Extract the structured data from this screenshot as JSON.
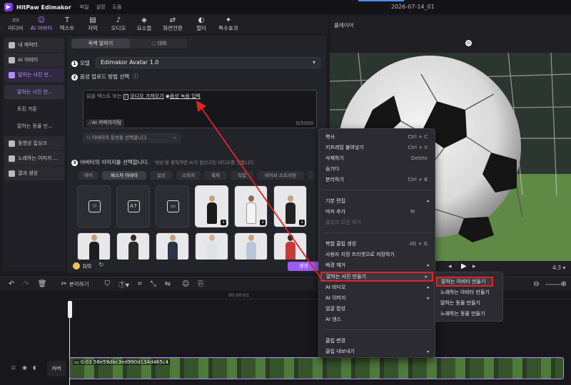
{
  "titlebar": {
    "app": "HitPaw Edimakor",
    "menus": [
      "파일",
      "설정",
      "도움"
    ],
    "date": "2026-07-14_01"
  },
  "tabs": [
    {
      "icon": "media-icon",
      "glyph": "▭",
      "label": "미디어"
    },
    {
      "icon": "ai-avatar-icon",
      "glyph": "☺",
      "label": "AI 아바타"
    },
    {
      "icon": "text-icon",
      "glyph": "T",
      "label": "텍스트"
    },
    {
      "icon": "subtitle-icon",
      "glyph": "▤",
      "label": "자막"
    },
    {
      "icon": "audio-icon",
      "glyph": "♪",
      "label": "오디오"
    },
    {
      "icon": "elements-icon",
      "glyph": "◈",
      "label": "요소들"
    },
    {
      "icon": "transition-icon",
      "glyph": "⇄",
      "label": "화면전환"
    },
    {
      "icon": "filter-icon",
      "glyph": "◐",
      "label": "필터"
    },
    {
      "icon": "effects-icon",
      "glyph": "✦",
      "label": "특수효과"
    }
  ],
  "sidebar": {
    "items": [
      {
        "label": "내 캐릭터"
      },
      {
        "label": "AI 아바타"
      },
      {
        "label": "말하는 사진 만..."
      },
      {
        "label": "말하는 사진 만..."
      },
      {
        "label": "토킹 카툰"
      },
      {
        "label": "말하는 동물 만..."
      },
      {
        "label": "동영상 립싱크"
      },
      {
        "label": "노래하는 이미지 ..."
      },
      {
        "label": "결과 생성"
      }
    ]
  },
  "main": {
    "seg_tabs": [
      "독백 말하기",
      "대화"
    ],
    "step1_label": "모델",
    "model_value": "Edimakor Avatar 1.0",
    "step2_label": "음성 업로드 방법 선택",
    "textarea_hint_prefix": "읽을 텍스트 또는",
    "import_audio": "오디오 가져오기",
    "record_audio": "음성 녹음 입력",
    "ai_copywriting": "AI 카피라이팅",
    "char_count": "0/5000",
    "voice_select": "아바타의 음성을 선택합니다.",
    "step3_label": "아바타의 이미지를 선택합니다.",
    "step3_hint": "'생성'을 클릭하면 AI가 립싱크된 비디오를 만듭니다.",
    "categories": [
      "마이",
      "제스처 아바타",
      "일상",
      "스피치",
      "축제",
      "직업",
      "라이브 스트리밍"
    ],
    "credits": "0/0",
    "generate": "생성"
  },
  "preview": {
    "header": "플레이어",
    "ratio": "4:3"
  },
  "toolbar": {
    "split_label": "분리하기"
  },
  "timeline": {
    "ruler_mark": "00:00:01",
    "clip_label": "0:03 58e59dbc3ed990d134d465c4",
    "cover_label": "커버"
  },
  "context_menu": {
    "items": [
      {
        "label": "복사",
        "shortcut": "Ctrl + C"
      },
      {
        "label": "키프레임 붙여넣기",
        "shortcut": "Ctrl + V"
      },
      {
        "label": "삭제하기",
        "shortcut": "Delete"
      },
      {
        "label": "숨기다",
        "shortcut": ""
      },
      {
        "label": "분리하기",
        "shortcut": "Ctrl + B"
      },
      {
        "label": "기본 편집",
        "shortcut": ""
      },
      {
        "label": "마커 추가",
        "shortcut": "M"
      },
      {
        "label": "클립의 모션 제거",
        "shortcut": ""
      },
      {
        "label": "복합 클립 생성",
        "shortcut": "Alt + G"
      },
      {
        "label": "사용자 지정 프리셋으로 저장하기",
        "shortcut": ""
      },
      {
        "label": "배경 제거",
        "shortcut": ""
      },
      {
        "label": "말하는 사진 만들기",
        "shortcut": ""
      },
      {
        "label": "AI 비디오",
        "shortcut": ""
      },
      {
        "label": "AI 이미지",
        "shortcut": ""
      },
      {
        "label": "얼굴 합성",
        "shortcut": ""
      },
      {
        "label": "AI 댄스",
        "shortcut": ""
      },
      {
        "label": "클립 변경",
        "shortcut": ""
      },
      {
        "label": "클립 내보내기",
        "shortcut": ""
      }
    ]
  },
  "submenu": {
    "items": [
      "말하는 아바타 만들기",
      "노래하는 아바타 만들기",
      "말하는 동물 만들기",
      "노래하는 동물 만들기"
    ]
  },
  "colors": {
    "accent": "#b58cff",
    "highlight": "#e02424"
  }
}
